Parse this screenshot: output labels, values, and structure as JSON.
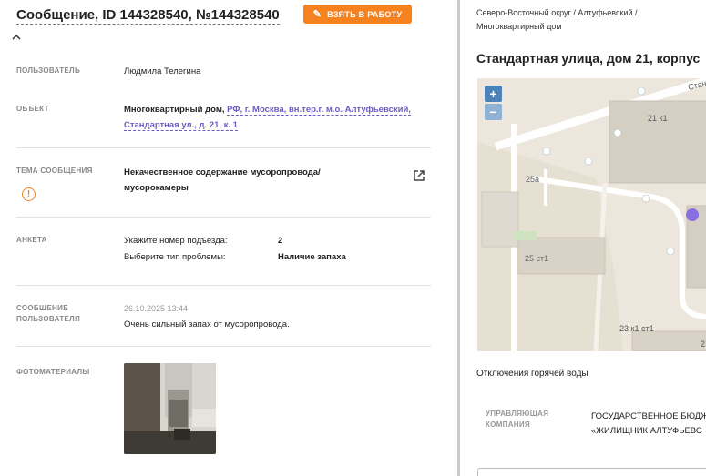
{
  "header": {
    "title": "Сообщение, ID 144328540, №144328540",
    "take_button": "ВЗЯТЬ В РАБОТУ"
  },
  "fields": {
    "user": {
      "label": "ПОЛЬЗОВАТЕЛЬ",
      "value": "Людмила Телегина"
    },
    "object": {
      "label": "ОБЪЕКТ",
      "type": "Многоквартирный дом,",
      "address_line1": "РФ, г. Москва, вн.тер.г. м.о. Алтуфьевский,",
      "address_line2": "Стандартная ул., д. 21, к. 1"
    },
    "topic": {
      "label": "ТЕМА СООБЩЕНИЯ",
      "line1": "Некачественное содержание мусоропровода/",
      "line2": "мусорокамеры"
    },
    "survey": {
      "label": "АНКЕТА",
      "q1": "Укажите номер подъезда:",
      "a1": "2",
      "q2": "Выберите тип проблемы:",
      "a2": "Наличие запаха"
    },
    "message": {
      "label_line1": "СООБЩЕНИЕ",
      "label_line2": "ПОЛЬЗОВАТЕЛЯ",
      "date": "26.10.2025 13:44",
      "text": "Очень сильный запах от мусоропровода."
    },
    "photos": {
      "label": "ФОТОМАТЕРИАЛЫ"
    }
  },
  "right": {
    "breadcrumb_line1": "Северо-Восточный округ / Алтуфьевский /",
    "breadcrumb_line2": "Многоквартирный дом",
    "address_title": "Стандартная улица, дом 21, корпус",
    "map": {
      "zoom_in": "+",
      "zoom_out": "−",
      "labels": {
        "b1": "21 к1",
        "b2": "25а",
        "b3": "25 ст1",
        "b4": "23 к1 ст1",
        "b5": "Станд",
        "b6": "2"
      },
      "marker_color": "#8a6fe0"
    },
    "hot_water": "Отключения горячей воды",
    "mc_label_line1": "УПРАВЛЯЮЩАЯ",
    "mc_label_line2": "КОМПАНИЯ",
    "mc_value_line1": "ГОСУДАРСТВЕННОЕ БЮДЖ",
    "mc_value_line2": "«ЖИЛИЩНИК АЛТУФЬЕВС"
  },
  "colors": {
    "accent": "#f5821f",
    "link": "#6b5cc4"
  }
}
